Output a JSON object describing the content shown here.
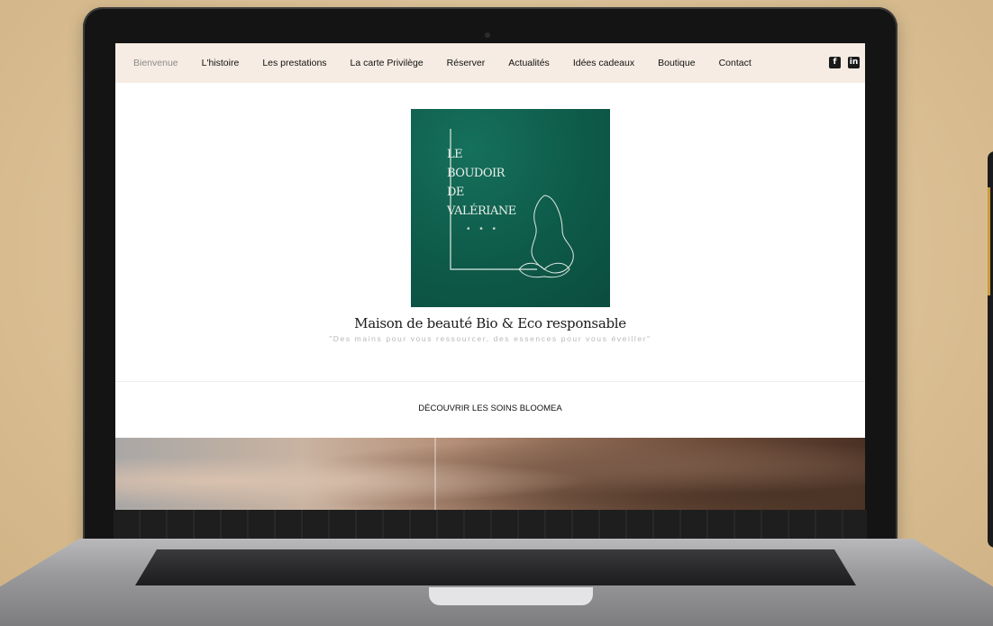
{
  "nav": {
    "items": [
      {
        "label": "Bienvenue",
        "active": true
      },
      {
        "label": "L'histoire"
      },
      {
        "label": "Les prestations"
      },
      {
        "label": "La carte Privilège"
      },
      {
        "label": "Réserver"
      },
      {
        "label": "Actualités"
      },
      {
        "label": "Idées cadeaux"
      },
      {
        "label": "Boutique"
      },
      {
        "label": "Contact"
      }
    ],
    "social": [
      {
        "icon": "facebook-icon",
        "glyph": "f"
      },
      {
        "icon": "linkedin-icon",
        "glyph": "in"
      }
    ]
  },
  "logo": {
    "lines": [
      "LE",
      "BOUDOIR",
      "DE",
      "VALÉRIANE"
    ],
    "dots": "• • •",
    "color": "#0e5a49"
  },
  "hero": {
    "title": "Maison de beauté Bio & Eco responsable",
    "tagline": "\"Des mains pour vous ressourcer, des essences pour vous éveiller\"",
    "cta": "DÉCOUVRIR LES SOINS BLOOMEA"
  },
  "colors": {
    "nav_bg": "#f6ece3",
    "accent_green": "#0e5a49",
    "background": "#dcc196"
  }
}
